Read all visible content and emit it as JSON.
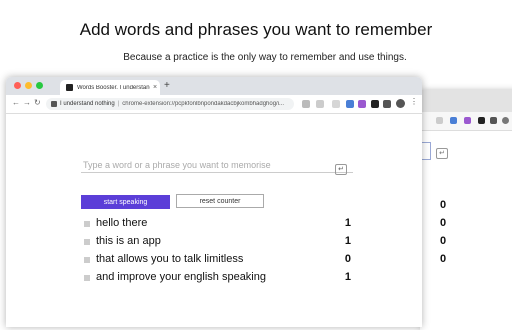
{
  "hero": {
    "title": "Add words and phrases you want to remember",
    "subtitle": "Because a practice is the only way to remember and use things."
  },
  "browser": {
    "tab_title": "Words Booster. I understand n",
    "tab_close": "×",
    "new_tab": "+",
    "nav": {
      "back": "←",
      "forward": "→",
      "reload": "↻"
    },
    "omnibox": {
      "site": "I understand nothing",
      "separator": "|",
      "url": "chrome-extension://pcpkfonlbnpondakdacbjkombhadghog/i..."
    },
    "kebab": "⋮",
    "accent": "#5b3ed8"
  },
  "form": {
    "input_placeholder": "Type a word or a phrase you want to memorise",
    "input_value": "",
    "enter_icon": "↵",
    "start_label": "start speaking",
    "reset_label": "reset counter"
  },
  "phrases": [
    {
      "text": "hello there",
      "count": "1"
    },
    {
      "text": "this is an app",
      "count": "1"
    },
    {
      "text": "that allows you to talk limitless",
      "count": "0"
    },
    {
      "text": "and improve your english speaking",
      "count": "1"
    }
  ],
  "back_window": {
    "enter_icon": "↵",
    "counts": [
      "0",
      "0",
      "0",
      "0"
    ]
  }
}
